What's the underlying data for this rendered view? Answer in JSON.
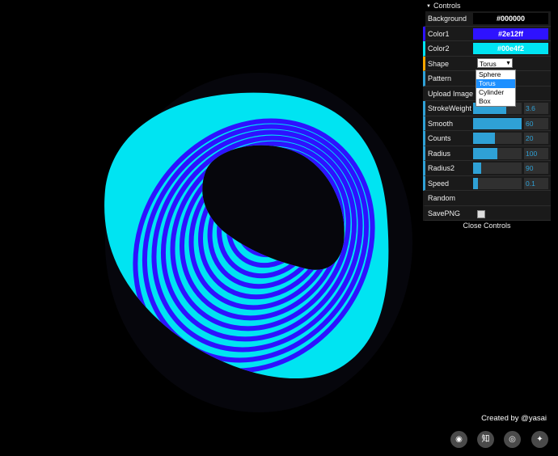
{
  "gui": {
    "header": "Controls",
    "close_label": "Close Controls",
    "rows": {
      "background": {
        "label": "Background",
        "value": "#000000",
        "color": "#000000",
        "text_color": "#ffffff"
      },
      "color1": {
        "label": "Color1",
        "value": "#2e12ff",
        "color": "#2e12ff",
        "text_color": "#ffffff"
      },
      "color2": {
        "label": "Color2",
        "value": "#00e4f2",
        "color": "#00e4f2",
        "text_color": "#ffffff"
      },
      "shape": {
        "label": "Shape",
        "value": "Torus",
        "options": [
          "Sphere",
          "Torus",
          "Cylinder",
          "Box"
        ]
      },
      "pattern": {
        "label": "Pattern"
      },
      "upload": {
        "label": "Upload Image"
      },
      "stroke_weight": {
        "label": "StrokeWeight",
        "value": "3.6",
        "fraction": 0.68
      },
      "smooth": {
        "label": "Smooth",
        "value": "60",
        "fraction": 1.0
      },
      "counts": {
        "label": "Counts",
        "value": "20",
        "fraction": 0.45
      },
      "radius": {
        "label": "Radius",
        "value": "100",
        "fraction": 0.5
      },
      "radius2": {
        "label": "Radius2",
        "value": "90",
        "fraction": 0.16
      },
      "speed": {
        "label": "Speed",
        "value": "0.1",
        "fraction": 0.1
      },
      "random": {
        "label": "Random"
      },
      "save_png": {
        "label": "SavePNG",
        "checked": false
      }
    }
  },
  "credit": "Created by @yasai",
  "social_icons": [
    "weibo-icon",
    "zhihu-icon",
    "instagram-icon",
    "twitter-icon"
  ],
  "social_glyphs": [
    "◉",
    "知",
    "◎",
    "✦"
  ],
  "scene": {
    "stripe_color": "#2e12ff",
    "base_color": "#00e4f2"
  }
}
